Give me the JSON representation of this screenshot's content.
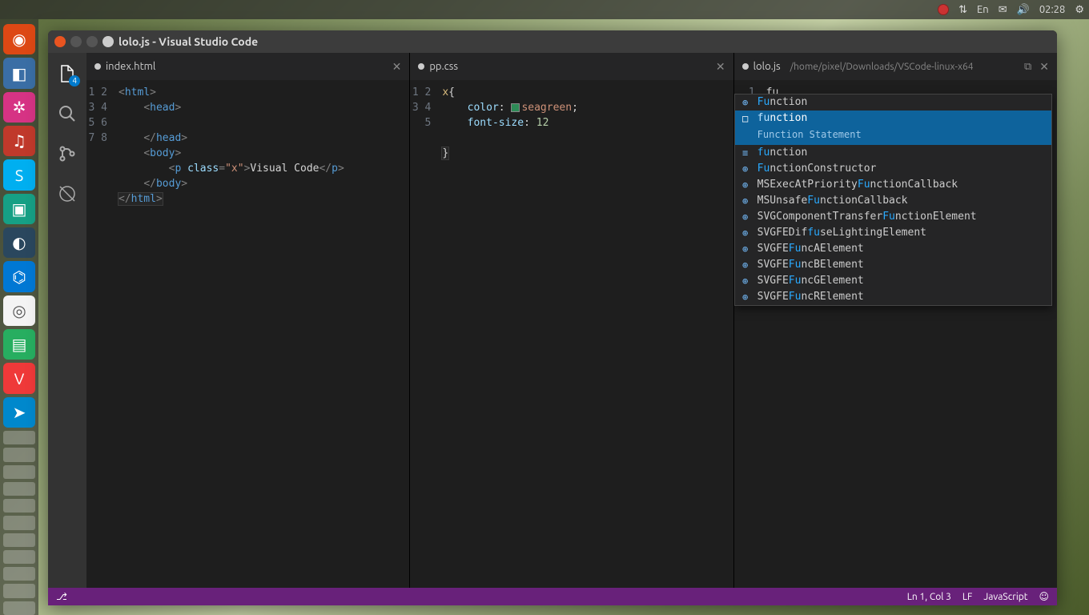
{
  "menubar": {
    "lang": "En",
    "time": "02:28"
  },
  "launcher": {
    "items": [
      {
        "name": "ubuntu",
        "glyph": "◉"
      },
      {
        "name": "app-blue",
        "glyph": "◧"
      },
      {
        "name": "app-pink",
        "glyph": "✲"
      },
      {
        "name": "app-music",
        "glyph": "♫"
      },
      {
        "name": "skype",
        "glyph": "S"
      },
      {
        "name": "app-teal",
        "glyph": "▣"
      },
      {
        "name": "steam",
        "glyph": "◐"
      },
      {
        "name": "vscode",
        "glyph": "⌬"
      },
      {
        "name": "chrome",
        "glyph": "◎"
      },
      {
        "name": "app-green",
        "glyph": "▤"
      },
      {
        "name": "vivaldi",
        "glyph": "V"
      },
      {
        "name": "telegram",
        "glyph": "➤"
      }
    ]
  },
  "window": {
    "title": "lolo.js - Visual Studio Code"
  },
  "activitybar": {
    "explorer_badge": "4"
  },
  "editors": [
    {
      "tab": "index.html",
      "dirty": true,
      "lines": [
        "1",
        "2",
        "3",
        "4",
        "5",
        "6",
        "7",
        "8"
      ]
    },
    {
      "tab": "pp.css",
      "dirty": true,
      "lines": [
        "1",
        "2",
        "3",
        "4",
        "5"
      ],
      "css": {
        "selector": "x",
        "prop1": "color",
        "val1": "seagreen",
        "prop2": "font-size",
        "val2": "12"
      }
    },
    {
      "tab": "lolo.js",
      "dirty": true,
      "path": "/home/pixel/Downloads/VSCode-linux-x64",
      "lines": [
        "1"
      ],
      "typed": "fu"
    }
  ],
  "html_code": {
    "tag_html": "html",
    "tag_head": "head",
    "tag_body": "body",
    "tag_p": "p",
    "attr_class": "class",
    "val_x": "\"x\"",
    "text": "Visual Code"
  },
  "suggest": {
    "items": [
      {
        "icon": "⊕",
        "pre": "Fu",
        "rest": "nction"
      },
      {
        "icon": "□",
        "pre": "fu",
        "rest": "nction",
        "selected": true,
        "detail": "Function Statement"
      },
      {
        "icon": "≡",
        "pre": "fu",
        "rest": "nction"
      },
      {
        "icon": "⊕",
        "pre": "Fu",
        "rest": "nctionConstructor"
      },
      {
        "icon": "⊕",
        "preText": "MSExecAtPriority",
        "pre": "Fu",
        "rest": "nctionCallback"
      },
      {
        "icon": "⊕",
        "preText": "MSUnsafe",
        "pre": "Fu",
        "rest": "nctionCallback"
      },
      {
        "icon": "⊕",
        "preText": "SVGComponentTransfer",
        "pre": "Fu",
        "rest": "nctionElement"
      },
      {
        "icon": "⊕",
        "preText": "SVGFEDif",
        "pre": "fu",
        "rest": "seLightingElement"
      },
      {
        "icon": "⊕",
        "preText": "SVGFE",
        "pre": "Fu",
        "rest": "ncAElement"
      },
      {
        "icon": "⊕",
        "preText": "SVGFE",
        "pre": "Fu",
        "rest": "ncBElement"
      },
      {
        "icon": "⊕",
        "preText": "SVGFE",
        "pre": "Fu",
        "rest": "ncGElement"
      },
      {
        "icon": "⊕",
        "preText": "SVGFE",
        "pre": "Fu",
        "rest": "ncRElement"
      }
    ]
  },
  "statusbar": {
    "git_glyph": "⎇",
    "ln_col": "Ln 1, Col 3",
    "eol": "LF",
    "lang": "JavaScript",
    "smile": "☺"
  }
}
